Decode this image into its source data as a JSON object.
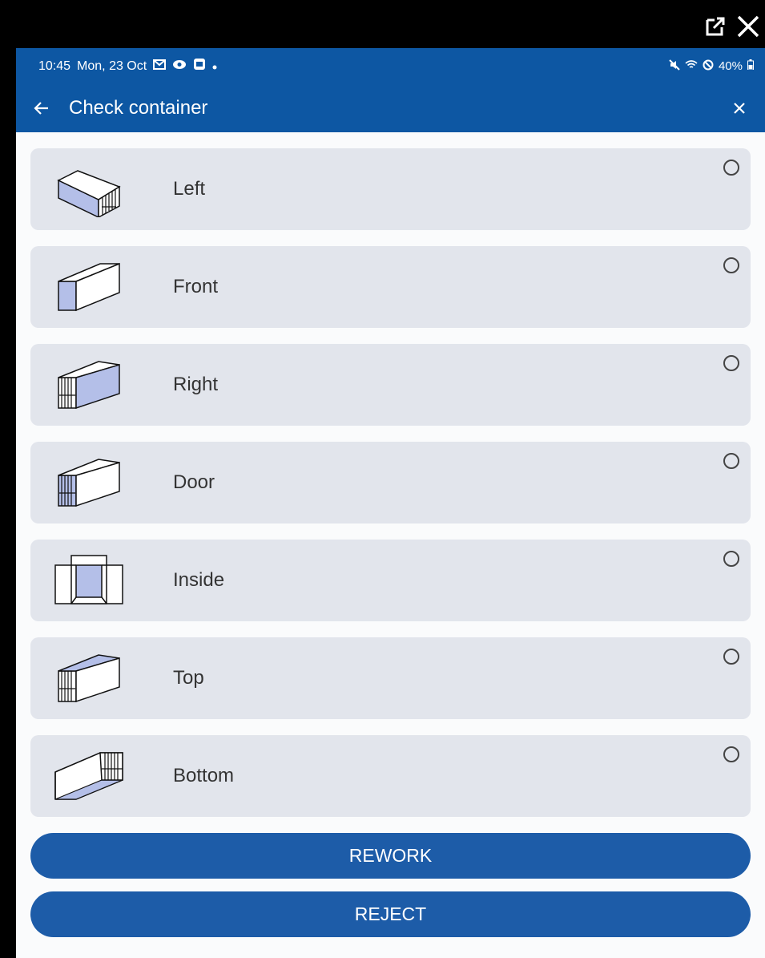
{
  "frame": {
    "icons": [
      "open-external-icon",
      "close-icon"
    ]
  },
  "status_bar": {
    "time": "10:45",
    "date": "Mon, 23 Oct",
    "battery": "40%",
    "icons_left": [
      "mail-icon",
      "eye-icon",
      "screen-mirror-icon",
      "dot-icon"
    ],
    "icons_right": [
      "mute-icon",
      "wifi-icon",
      "dnd-icon",
      "battery-icon"
    ]
  },
  "app_bar": {
    "title": "Check container"
  },
  "options": [
    {
      "label": "Left",
      "selected": false
    },
    {
      "label": "Front",
      "selected": false
    },
    {
      "label": "Right",
      "selected": false
    },
    {
      "label": "Door",
      "selected": false
    },
    {
      "label": "Inside",
      "selected": false
    },
    {
      "label": "Top",
      "selected": false
    },
    {
      "label": "Bottom",
      "selected": false
    }
  ],
  "actions": {
    "rework_label": "REWORK",
    "reject_label": "REJECT"
  },
  "colors": {
    "primary": "#0d57a3",
    "button": "#1d5ca8",
    "card": "#e2e5ec",
    "highlight": "#b4bfe8"
  }
}
